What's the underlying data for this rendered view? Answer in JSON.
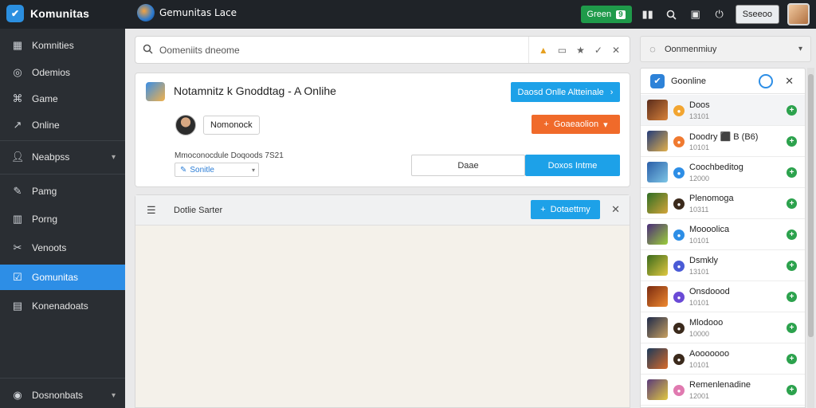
{
  "brand": {
    "title": "Komunitas",
    "logo_icon": "komunitas-logo-icon"
  },
  "app": {
    "title": "Gemunitas Lace"
  },
  "topbar": {
    "online_label": "Green",
    "online_count": "9",
    "session_label": "Sseeoo",
    "icons": [
      "chart-icon",
      "search-icon",
      "image-icon",
      "power-icon"
    ]
  },
  "sidebar": {
    "items": [
      {
        "label": "Komnities",
        "icon": "grid-icon"
      },
      {
        "label": "Odemios",
        "icon": "globe-icon"
      },
      {
        "label": "Game",
        "icon": "gamepad-icon"
      },
      {
        "label": "Online",
        "icon": "trend-icon"
      },
      {
        "label": "Neabpss",
        "icon": "user-icon"
      },
      {
        "label": "Pamg",
        "icon": "pen-icon"
      },
      {
        "label": "Porng",
        "icon": "bar-chart-icon"
      },
      {
        "label": "Venoots",
        "icon": "tools-icon"
      },
      {
        "label": "Gomunitas",
        "icon": "check-square-icon"
      },
      {
        "label": "Konenadoats",
        "icon": "calendar-icon"
      }
    ],
    "footer_label": "Dosnonbats",
    "active_index": 8
  },
  "search": {
    "placeholder": "Oomeniits dneome"
  },
  "card": {
    "title": "Notamnitz k Gnoddtag - A Onlihe",
    "primary_button": "Daosd Onlle Altteinale",
    "user_name": "Nomonock",
    "orange_button": "Goaeaolion",
    "meta": "Mmoconocdule Doqoods 7S21",
    "status_value": "Sonitle",
    "cancel_button": "Daae",
    "confirm_button": "Doxos Intme"
  },
  "panel": {
    "title": "Dotlie Sarter",
    "button": "Dotaettmy"
  },
  "right": {
    "header_label": "Oonmenmiuy",
    "panel_title": "Goonline",
    "items": [
      {
        "name": "Doos",
        "sub": "13101",
        "badge_color": "#f2a531",
        "thumb": [
          "#5a2c1c",
          "#d8823a"
        ]
      },
      {
        "name": "Doodry ⬛ B (B6)",
        "sub": "10101",
        "badge_color": "#f07a30",
        "thumb": [
          "#243c7a",
          "#e2b04c"
        ]
      },
      {
        "name": "Coochbeditog",
        "sub": "12000",
        "badge_color": "#2d8ee6",
        "thumb": [
          "#2a5ea8",
          "#7ec6e6"
        ]
      },
      {
        "name": "Plenomoga",
        "sub": "10311",
        "badge_color": "#3b2a1c",
        "thumb": [
          "#2f6e24",
          "#d3a43a"
        ]
      },
      {
        "name": "Moooolica",
        "sub": "10101",
        "badge_color": "#2d8ee6",
        "thumb": [
          "#4a2c7a",
          "#9ccf3a"
        ]
      },
      {
        "name": "Dsmkly",
        "sub": "13101",
        "badge_color": "#4a5bd6",
        "thumb": [
          "#3a6a1c",
          "#e0c840"
        ]
      },
      {
        "name": "Onsdoood",
        "sub": "10101",
        "badge_color": "#6a4ad6",
        "thumb": [
          "#7a2a10",
          "#f08a30"
        ]
      },
      {
        "name": "Mlodooo",
        "sub": "10000",
        "badge_color": "#3b2a1c",
        "thumb": [
          "#1e2a4a",
          "#c8a060"
        ]
      },
      {
        "name": "Aooooooo",
        "sub": "10101",
        "badge_color": "#3b2a1c",
        "thumb": [
          "#1c3a5a",
          "#d86a2a"
        ]
      },
      {
        "name": "Remenlenadine",
        "sub": "12001",
        "badge_color": "#e07ab0",
        "thumb": [
          "#5a3a7a",
          "#e0c840"
        ]
      }
    ]
  },
  "colors": {
    "accent_blue": "#1da1e8",
    "accent_orange": "#f06a2a",
    "online_green": "#1f9a4a",
    "sidebar_bg": "#2a2e33",
    "sidebar_active": "#2d8ee6"
  }
}
